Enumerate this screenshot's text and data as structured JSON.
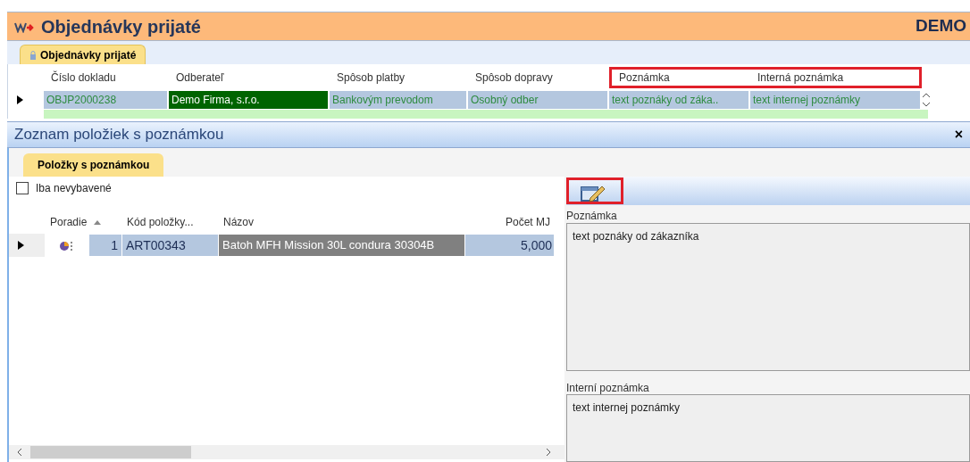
{
  "window": {
    "title": "Objednávky prijaté",
    "badge": "DEMO"
  },
  "tabs": [
    {
      "label": "Objednávky prijaté",
      "selected": true
    }
  ],
  "orders": {
    "columns": [
      {
        "label": "Číslo dokladu",
        "highlighted": false
      },
      {
        "label": "Odberateľ",
        "highlighted": false
      },
      {
        "label": "Spôsob platby",
        "highlighted": false
      },
      {
        "label": "Spôsob dopravy",
        "highlighted": false
      },
      {
        "label": "Poznámka",
        "highlighted": true
      },
      {
        "label": "Interná poznámka",
        "highlighted": true
      }
    ],
    "rows": [
      {
        "selected": true,
        "cells": [
          {
            "text": "OBJP2000238",
            "emphasis": false
          },
          {
            "text": "Demo Firma, s.r.o.",
            "emphasis": true
          },
          {
            "text": "Bankovým prevodom",
            "emphasis": false
          },
          {
            "text": "Osobný odber",
            "emphasis": false
          },
          {
            "text": "text poznáky od záka..",
            "emphasis": false
          },
          {
            "text": "text internej poznámky",
            "emphasis": false
          }
        ]
      }
    ]
  },
  "panel": {
    "title": "Zoznam položiek s poznámkou",
    "close": "×",
    "tabs": [
      {
        "label": "Položky s poznámkou",
        "selected": true
      }
    ],
    "filter": {
      "label": "Iba nevybavené",
      "checked": false
    },
    "items": {
      "columns": [
        {
          "label": "Poradie",
          "sorted": true
        },
        {
          "label": "Kód položky...",
          "sorted": false
        },
        {
          "label": "Názov",
          "sorted": false
        },
        {
          "label": "Počet MJ",
          "sorted": false
        }
      ],
      "rows": [
        {
          "selected": true,
          "order": "1",
          "code": "ART00343",
          "name": "Batoh MFH Mission 30L condura 30304B",
          "quantity": "5,000"
        }
      ]
    },
    "edit_highlighted": true,
    "note": {
      "label": "Poznámka",
      "value": "text poznáky od zákazníka"
    },
    "internal_note": {
      "label": "Interní poznámka",
      "value": "text internej poznámky"
    }
  }
}
